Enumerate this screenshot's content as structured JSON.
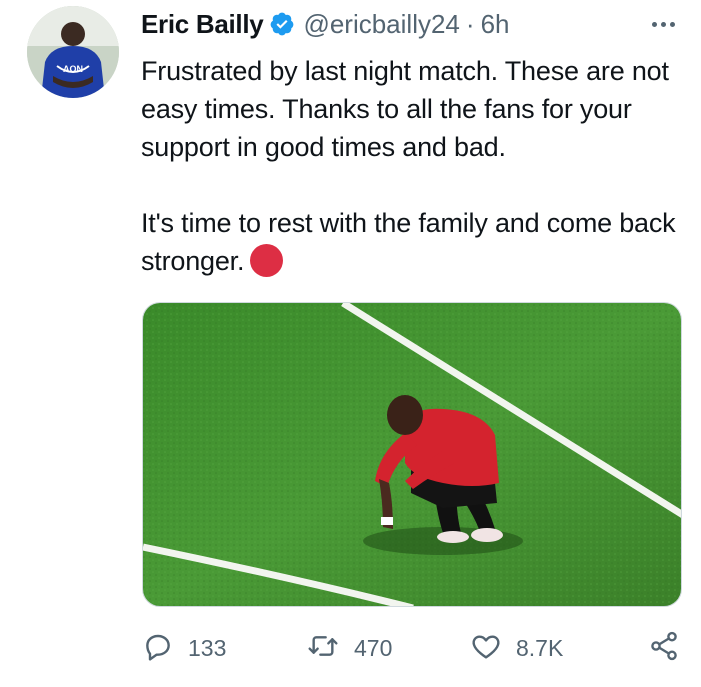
{
  "tweet": {
    "author_name": "Eric Bailly",
    "handle": "@ericbailly24",
    "separator": "·",
    "time": "6h",
    "paragraph1": "Frustrated by last night match. These are not easy times. Thanks to all the fans for your support in good times and bad.",
    "paragraph2": "It's time to rest with the family and come back stronger.",
    "emoji_color": "#dd2e44"
  },
  "actions": {
    "replies": "133",
    "retweets": "470",
    "likes": "8.7K"
  },
  "icons": {
    "verified": "verified-badge-icon",
    "more": "more-dots-icon",
    "reply": "reply-icon",
    "retweet": "retweet-icon",
    "like": "heart-icon",
    "share": "share-icon"
  },
  "colors": {
    "verified_blue": "#1d9bf0",
    "muted_text": "#536471",
    "pitch_green": "#3f8a2c",
    "kit_red": "#d4232e"
  }
}
